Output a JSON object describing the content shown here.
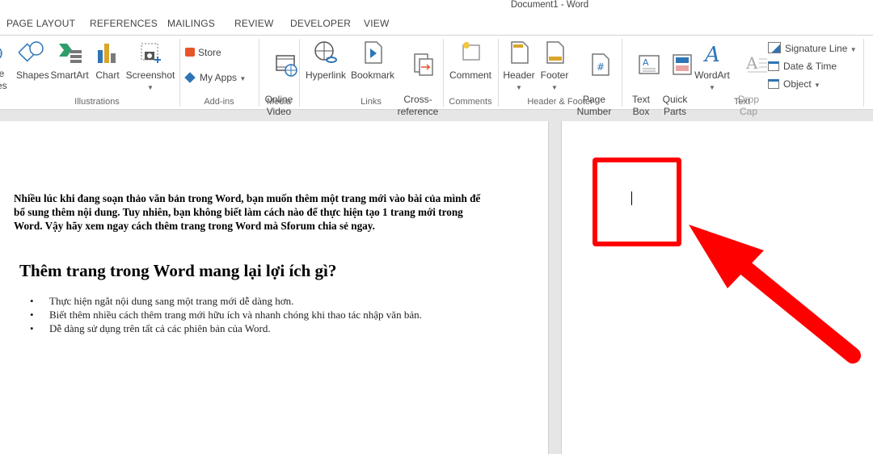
{
  "window": {
    "title": "Document1 - Word"
  },
  "tabs": [
    "PAGE LAYOUT",
    "REFERENCES",
    "MAILINGS",
    "REVIEW",
    "DEVELOPER",
    "VIEW"
  ],
  "ribbon": {
    "illustrations": {
      "pictures_cut": "re",
      "online_pictures_cut": "ne\nres",
      "shapes": "Shapes",
      "smartart": "SmartArt",
      "chart": "Chart",
      "screenshot": "Screenshot",
      "label": "Illustrations"
    },
    "addins": {
      "store": "Store",
      "my_apps": "My Apps",
      "label": "Add-ins"
    },
    "media": {
      "online_video": "Online\nVideo",
      "label": "Media"
    },
    "links": {
      "hyperlink": "Hyperlink",
      "bookmark": "Bookmark",
      "cross_reference": "Cross-\nreference",
      "label": "Links"
    },
    "comments": {
      "comment": "Comment",
      "label": "Comments"
    },
    "header_footer": {
      "header": "Header",
      "footer": "Footer",
      "page_number": "Page\nNumber",
      "label": "Header & Footer"
    },
    "text": {
      "text_box": "Text\nBox",
      "quick_parts": "Quick\nParts",
      "wordart": "WordArt",
      "drop_cap": "Drop\nCap",
      "signature_line": "Signature Line",
      "date_time": "Date & Time",
      "object": "Object",
      "label": "Text"
    }
  },
  "document": {
    "intro": "Nhiều lúc khi đang soạn thảo văn bản trong Word, bạn muốn thêm một trang mới vào bài của mình để bổ sung thêm nội dung. Tuy nhiên, bạn không biết làm cách nào để thực hiện tạo 1 trang mới trong Word. Vậy hãy xem ngay cách thêm trang trong Word mà Sforum chia sẻ ngay.",
    "heading": "Thêm trang trong Word mang lại lợi ích gì?",
    "bullets": [
      "Thực hiện ngắt nội dung sang một trang mới dễ dàng hơn.",
      "Biết thêm nhiều cách thêm trang mới hữu ích và nhanh chóng khi thao tác nhập văn bản.",
      "Dễ dàng sử dụng trên tất cả các phiên bản của Word."
    ]
  },
  "annotation": {
    "color": "#ff0000"
  }
}
